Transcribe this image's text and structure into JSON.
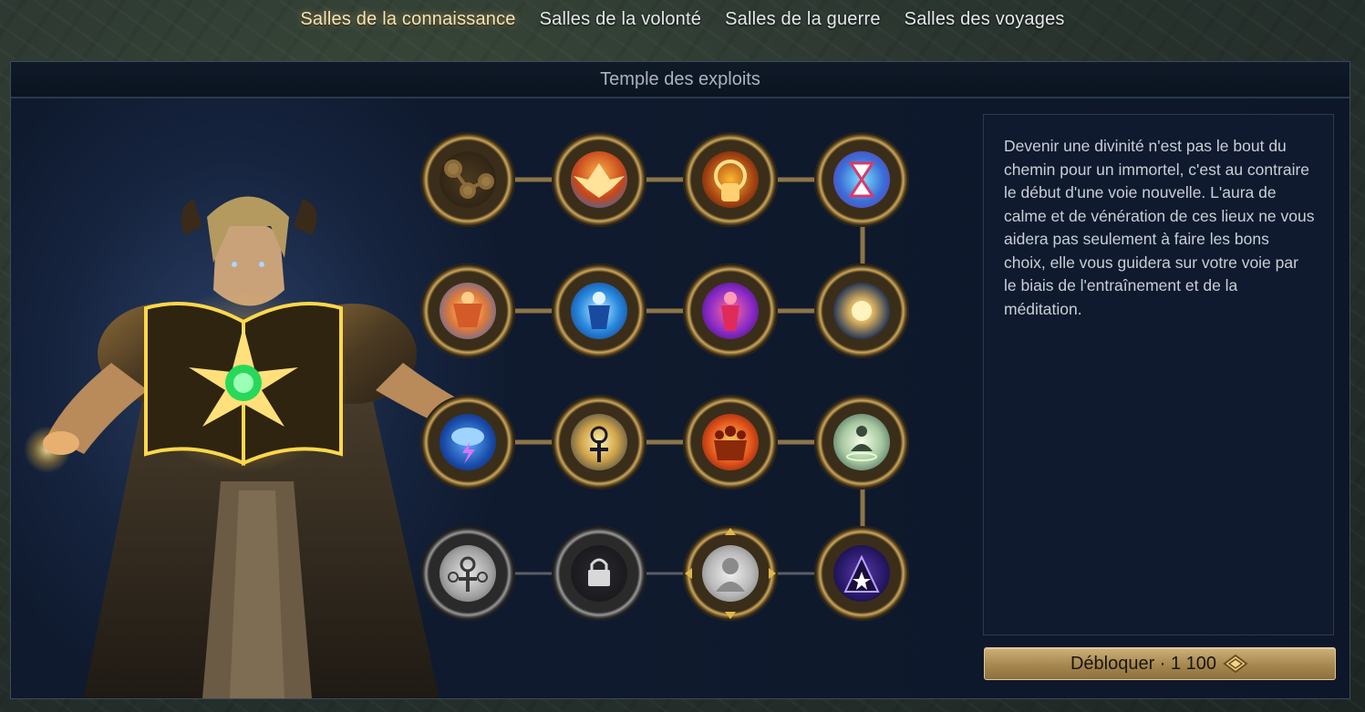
{
  "tabs": [
    {
      "label": "Salles de la connaissance",
      "active": true
    },
    {
      "label": "Salles de la volonté",
      "active": false
    },
    {
      "label": "Salles de la guerre",
      "active": false
    },
    {
      "label": "Salles des voyages",
      "active": false
    }
  ],
  "panel": {
    "title": "Temple des exploits"
  },
  "description": "Devenir une divinité n'est pas le bout du chemin pour un immortel, c'est au contraire le début d'une voie nouvelle. L'aura de calme et de vénération de ces lieux ne vous aidera pas seulement à faire les bons choix, elle vous guidera sur votre voie par le biais de l'entraînement et de la méditation.",
  "unlock_button": {
    "label": "Débloquer · 1 100",
    "currency_icon": "diamond-currency-icon"
  },
  "colors": {
    "accent_gold": "#cfa85a",
    "active_tab": "#f6e4b4",
    "panel_bg": "#0c1628"
  },
  "nodes": [
    {
      "icon": "network-icon",
      "state": "unlocked"
    },
    {
      "icon": "phoenix-icon",
      "state": "unlocked"
    },
    {
      "icon": "golden-fist-icon",
      "state": "unlocked"
    },
    {
      "icon": "hourglass-icon",
      "state": "unlocked"
    },
    {
      "icon": "flexing-warrior-icon",
      "state": "unlocked"
    },
    {
      "icon": "blue-warrior-icon",
      "state": "unlocked"
    },
    {
      "icon": "crimson-figure-icon",
      "state": "unlocked"
    },
    {
      "icon": "light-orb-icon",
      "state": "unlocked"
    },
    {
      "icon": "storm-cloud-icon",
      "state": "unlocked"
    },
    {
      "icon": "sword-emblem-icon",
      "state": "unlocked"
    },
    {
      "icon": "fire-warriors-icon",
      "state": "unlocked"
    },
    {
      "icon": "meditation-icon",
      "state": "unlocked"
    },
    {
      "icon": "triple-sword-emblem-icon",
      "state": "locked"
    },
    {
      "icon": "lock-icon",
      "state": "locked"
    },
    {
      "icon": "monk-bust-icon",
      "state": "available"
    },
    {
      "icon": "dark-star-icon",
      "state": "unlocked"
    }
  ]
}
